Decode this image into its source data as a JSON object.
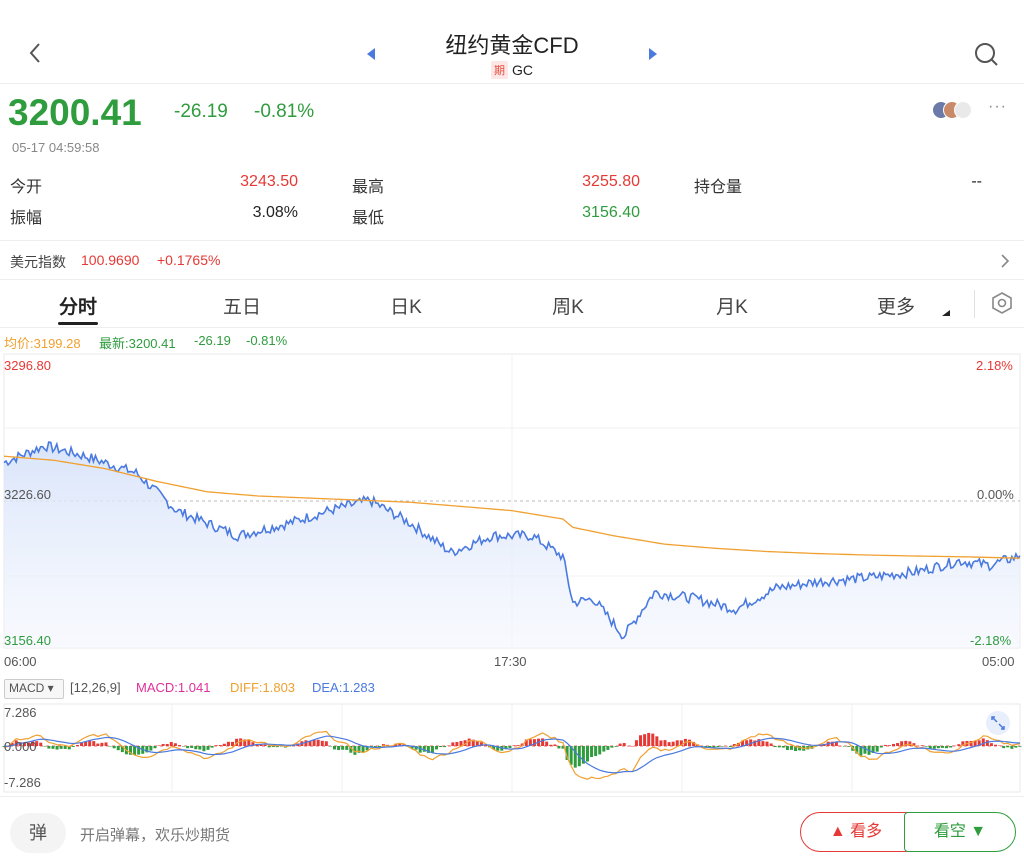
{
  "header": {
    "title": "纽约黄金CFD",
    "badge": "期",
    "code": "GC"
  },
  "quote": {
    "price": "3200.41",
    "change": "-26.19",
    "change_pct": "-0.81%",
    "timestamp": "05-17 04:59:58",
    "more": "···"
  },
  "stats": {
    "open_label": "今开",
    "open": "3243.50",
    "high_label": "最高",
    "high": "3255.80",
    "oi_label": "持仓量",
    "oi": "--",
    "amp_label": "振幅",
    "amp": "3.08%",
    "low_label": "最低",
    "low": "3156.40"
  },
  "index": {
    "name": "美元指数",
    "value": "100.9690",
    "change": "+0.1765%"
  },
  "tabs": [
    "分时",
    "五日",
    "日K",
    "周K",
    "月K",
    "更多"
  ],
  "legend": {
    "avg": "均价:3199.28",
    "latest": "最新:3200.41",
    "chg": "-26.19",
    "pct": "-0.81%"
  },
  "chart_labels": {
    "y_top": "3296.80",
    "y_mid": "3226.60",
    "y_bot": "3156.40",
    "pct_top": "2.18%",
    "pct_mid": "0.00%",
    "pct_bot": "-2.18%",
    "x_start": "06:00",
    "x_mid": "17:30",
    "x_end": "05:00"
  },
  "macd": {
    "selector": "MACD",
    "params": "[12,26,9]",
    "macd": "MACD:1.041",
    "diff": "DIFF:1.803",
    "dea": "DEA:1.283",
    "y_top": "7.286",
    "y_mid": "0.000",
    "y_bot": "-7.286"
  },
  "bottom": {
    "danmu_btn": "弹",
    "danmu_text": "开启弹幕，欢乐炒期货",
    "bull": "看多",
    "bear": "看空"
  },
  "colors": {
    "up": "#e53935",
    "down": "#2f9c3e",
    "price_line": "#4a7ae0",
    "avg_line": "#f0a030",
    "macd_pink": "#e0309a",
    "diff_orange": "#f0a030",
    "dea_blue": "#4a7ae0"
  },
  "chart_data": {
    "type": "line",
    "title": "",
    "x_range": [
      "06:00",
      "05:00"
    ],
    "ylim": [
      3156.4,
      3296.8
    ],
    "reference": 3226.6,
    "series": [
      {
        "name": "最新",
        "x": [
          0,
          0.04,
          0.08,
          0.13,
          0.17,
          0.23,
          0.28,
          0.32,
          0.36,
          0.4,
          0.44,
          0.48,
          0.52,
          0.55,
          0.56,
          0.58,
          0.61,
          0.64,
          0.68,
          0.72,
          0.76,
          0.8,
          0.85,
          0.9,
          0.94,
          0.97,
          1.0
        ],
        "values": [
          3245,
          3253,
          3248,
          3240,
          3222,
          3210,
          3216,
          3222,
          3227,
          3216,
          3202,
          3210,
          3210,
          3200,
          3178,
          3180,
          3162,
          3183,
          3180,
          3175,
          3185,
          3188,
          3190,
          3193,
          3198,
          3196,
          3200.41
        ]
      },
      {
        "name": "均价",
        "x": [
          0,
          0.05,
          0.1,
          0.15,
          0.2,
          0.25,
          0.3,
          0.35,
          0.4,
          0.45,
          0.5,
          0.55,
          0.56,
          0.6,
          0.65,
          0.7,
          0.75,
          0.8,
          0.85,
          0.9,
          0.95,
          1.0
        ],
        "values": [
          3248,
          3246,
          3242,
          3236,
          3231,
          3229,
          3228,
          3227,
          3226,
          3224,
          3222,
          3218,
          3214,
          3210,
          3206,
          3204,
          3202.5,
          3201.5,
          3200.8,
          3200.3,
          3199.9,
          3199.28
        ]
      }
    ]
  }
}
